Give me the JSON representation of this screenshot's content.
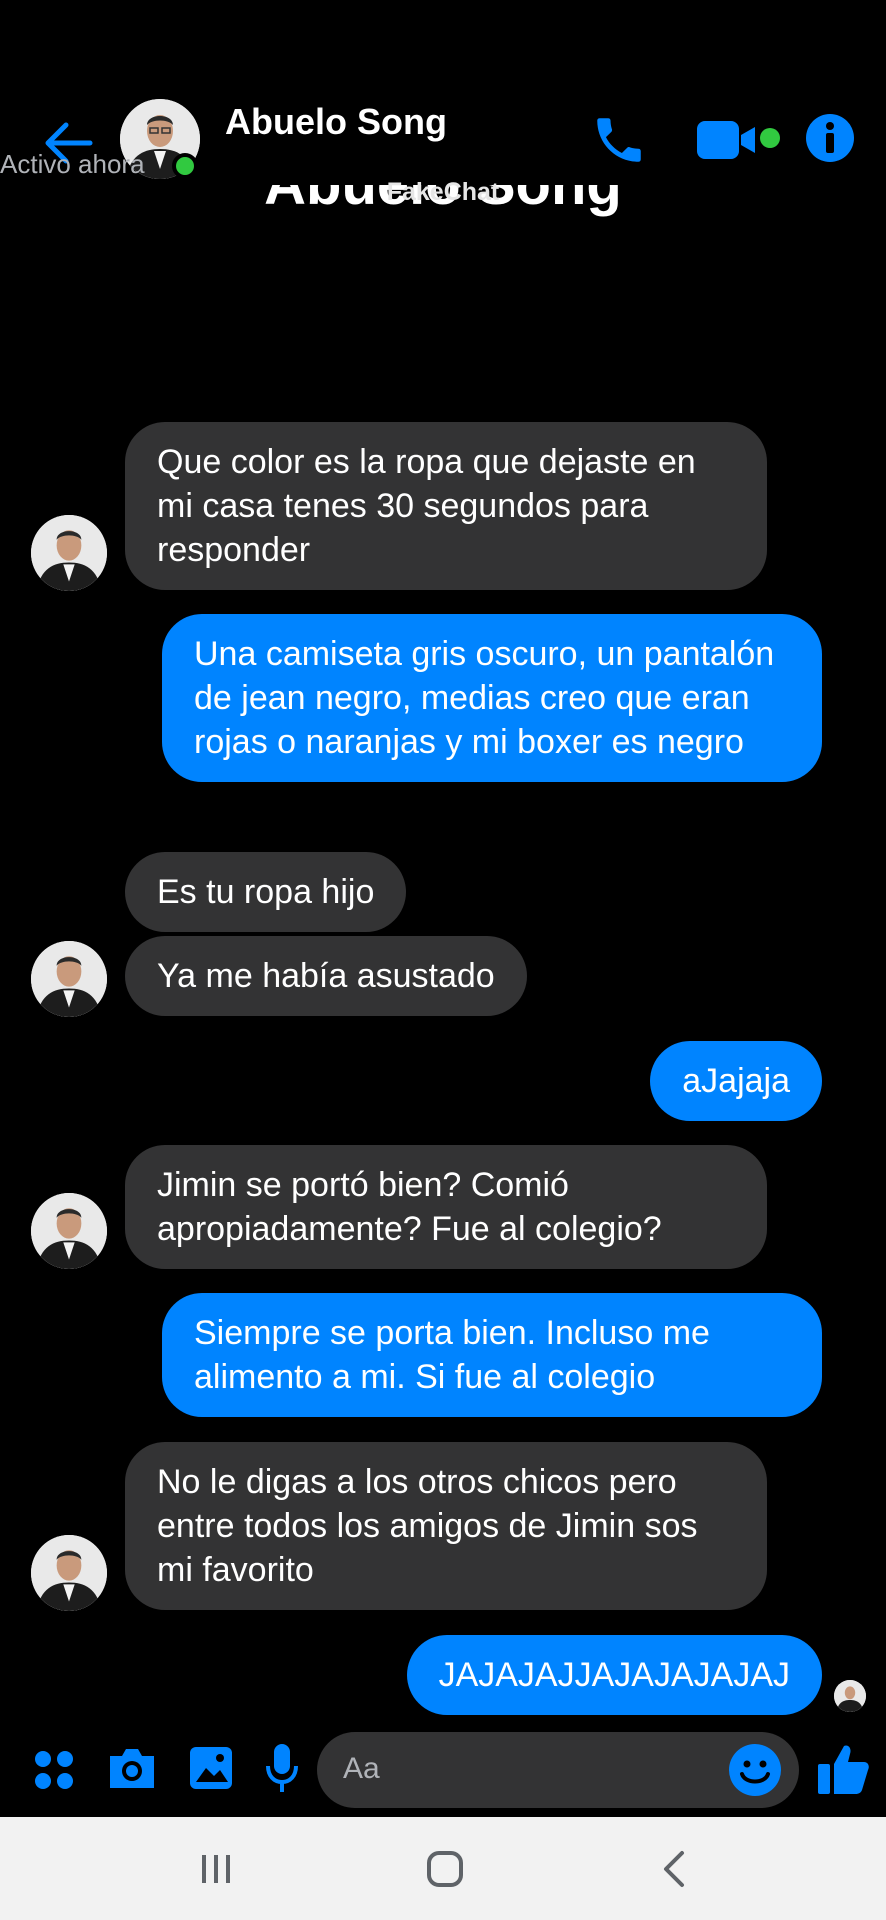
{
  "header": {
    "contact_name": "Abuelo Song",
    "status": "Activo ahora"
  },
  "conversation": {
    "ghost_title": "Abuelo Song",
    "watermark": "FakeChat"
  },
  "messages": [
    {
      "side": "in",
      "text": "Que color es la ropa que dejaste en mi casa tenes 30 segundos para responder"
    },
    {
      "side": "out",
      "text": "Una camiseta gris oscuro, un pantalón de jean negro, medias creo que eran rojas o naranjas y mi boxer es negro"
    },
    {
      "side": "in",
      "text": "Es tu ropa hijo"
    },
    {
      "side": "in",
      "text": "Ya me había asustado"
    },
    {
      "side": "out",
      "text": "aJajaja"
    },
    {
      "side": "in",
      "text": "Jimin se portó bien? Comió apropiadamente? Fue al colegio?"
    },
    {
      "side": "out",
      "text": "Siempre se porta bien. Incluso me alimento a mi. Si fue al colegio"
    },
    {
      "side": "in",
      "text": "No le digas a los otros chicos pero entre todos los amigos de Jimin sos mi favorito"
    },
    {
      "side": "out",
      "text": "JAJAJAJJAJAJAJAJAJ"
    }
  ],
  "composer": {
    "placeholder": "Aa"
  },
  "colors": {
    "accent": "#0084ff",
    "incoming_bubble": "#333334",
    "online": "#31c940",
    "background": "#000000"
  },
  "icons": [
    "back-arrow-icon",
    "phone-icon",
    "video-camera-icon",
    "info-icon",
    "apps-grid-icon",
    "camera-icon",
    "gallery-icon",
    "microphone-icon",
    "emoji-icon",
    "thumbs-up-icon",
    "recent-apps-icon",
    "home-icon",
    "nav-back-icon"
  ]
}
